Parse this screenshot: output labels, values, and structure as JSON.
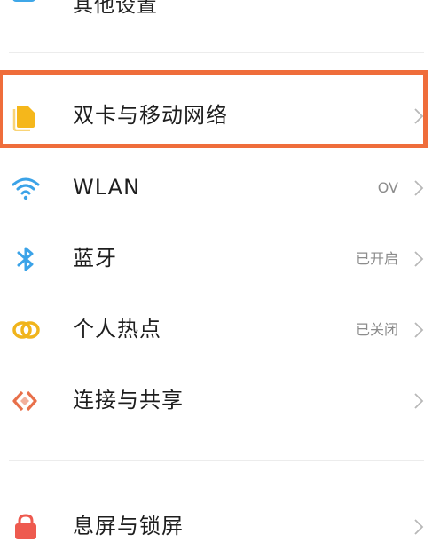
{
  "settings": {
    "top_cut_label": "其他设置",
    "items": [
      {
        "label": "双卡与移动网络",
        "value": "",
        "icon": "sim-card-icon",
        "icon_color": "#f5b71b"
      },
      {
        "label": "WLAN",
        "value": "OV",
        "icon": "wifi-icon",
        "icon_color": "#3ba3e8"
      },
      {
        "label": "蓝牙",
        "value": "已开启",
        "icon": "bluetooth-icon",
        "icon_color": "#3ba3e8"
      },
      {
        "label": "个人热点",
        "value": "已关闭",
        "icon": "hotspot-icon",
        "icon_color": "#f0b41c"
      },
      {
        "label": "连接与共享",
        "value": "",
        "icon": "connection-share-icon",
        "icon_color": "#e8704a"
      },
      {
        "label": "息屏与锁屏",
        "value": "",
        "icon": "lock-icon",
        "icon_color": "#ee5a4f"
      }
    ]
  },
  "highlight_color": "#ef6d3b"
}
